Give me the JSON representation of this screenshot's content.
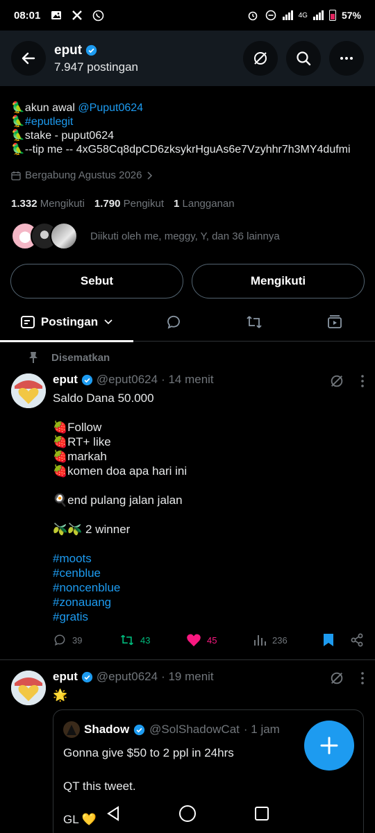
{
  "status_bar": {
    "time": "08:01",
    "network": "4G",
    "battery": "57%",
    "icons": [
      "gallery-icon",
      "x-logo-icon",
      "whatsapp-icon",
      "alarm-icon",
      "dnd-icon",
      "signal-icon",
      "battery-icon"
    ]
  },
  "header": {
    "name": "eput",
    "posts_count": "7.947 postingan"
  },
  "bio": {
    "line1_prefix": "🦜akun awal ",
    "line1_mention": "@Puput0624",
    "line2_prefix": "🦜",
    "line2_hashtag": "#eputlegit",
    "line3": "🦜stake - puput0624",
    "line4": "🦜--tip me -- 4xG58Cq8dpCD6zksykrHguAs6e7Vzyhhr7h3MY4dufmi"
  },
  "joined": "Bergabung Agustus 2026",
  "stats": {
    "following_count": "1.332",
    "following_label": "Mengikuti",
    "followers_count": "1.790",
    "followers_label": "Pengikut",
    "subs_count": "1",
    "subs_label": "Langganan"
  },
  "followed_by": "Diikuti oleh me, meggy, Y, dan 36 lainnya",
  "actions": {
    "mention": "Sebut",
    "following": "Mengikuti"
  },
  "tabs": {
    "posts": "Postingan"
  },
  "pinned_label": "Disematkan",
  "tweet1": {
    "name": "eput",
    "handle": "@eput0624",
    "time": "· 14 menit",
    "lines": [
      "Saldo Dana 50.000",
      "",
      "🍓Follow",
      "🍓RT+ like",
      "🍓markah",
      "🍓komen doa apa hari ini",
      "",
      "🍳end pulang jalan jalan",
      "",
      "🫒🫒 2 winner",
      ""
    ],
    "hashtags": [
      "#moots",
      "#cenblue",
      "#noncenblue",
      "#zonauang",
      "#gratis"
    ],
    "replies": "39",
    "reposts": "43",
    "likes": "45",
    "views": "236"
  },
  "tweet2": {
    "name": "eput",
    "handle": "@eput0624",
    "time": "· 19 menit",
    "text": "🌟"
  },
  "quote": {
    "name": "Shadow",
    "handle": "@SolShadowCat",
    "time": "· 1 jam",
    "line1": "Gonna give $50 to 2 ppl in 24hrs",
    "line2": "QT this tweet.",
    "line3": "GL 💛"
  },
  "colors": {
    "accent": "#1d9bf0",
    "repost_active": "#00ba7c",
    "like_active": "#f91880",
    "muted": "#71767b",
    "header_bg": "#141a20"
  }
}
